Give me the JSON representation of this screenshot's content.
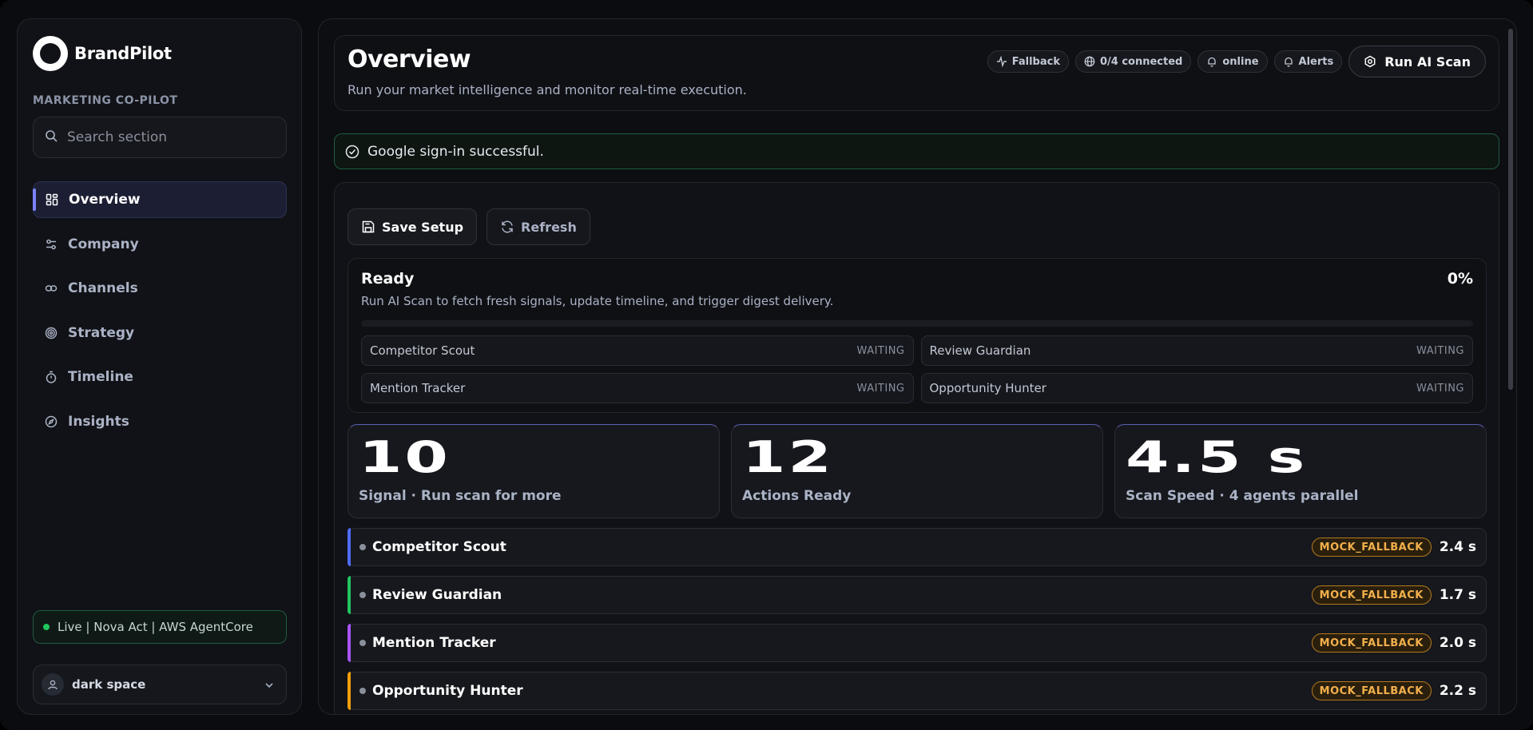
{
  "brand": {
    "name": "BrandPilot",
    "subtitle": "MARKETING CO-PILOT"
  },
  "search": {
    "placeholder": "Search section"
  },
  "nav": {
    "items": [
      {
        "label": "Overview",
        "icon": "dashboard-icon",
        "active": true
      },
      {
        "label": "Company",
        "icon": "sliders-icon"
      },
      {
        "label": "Channels",
        "icon": "link-icon"
      },
      {
        "label": "Strategy",
        "icon": "target-icon"
      },
      {
        "label": "Timeline",
        "icon": "stopwatch-icon"
      },
      {
        "label": "Insights",
        "icon": "compass-icon"
      }
    ]
  },
  "live_status": "Live | Nova Act | AWS AgentCore",
  "user": {
    "name": "dark space"
  },
  "header": {
    "title": "Overview",
    "subtitle": "Run your market intelligence and monitor real-time execution.",
    "chips": [
      "Fallback",
      "0/4 connected",
      "online",
      "Alerts"
    ],
    "run_label": "Run AI Scan"
  },
  "banner": "Google sign-in successful.",
  "toolbar": {
    "save_label": "Save Setup",
    "refresh_label": "Refresh"
  },
  "status": {
    "title": "Ready",
    "percent": "0%",
    "progress": 0,
    "description": "Run AI Scan to fetch fresh signals, update timeline, and trigger digest delivery.",
    "agents": [
      {
        "name": "Competitor Scout",
        "state": "WAITING"
      },
      {
        "name": "Review Guardian",
        "state": "WAITING"
      },
      {
        "name": "Mention Tracker",
        "state": "WAITING"
      },
      {
        "name": "Opportunity Hunter",
        "state": "WAITING"
      }
    ]
  },
  "stats": [
    {
      "value": "10",
      "label": "Signal · Run scan for more"
    },
    {
      "value": "12",
      "label": "Actions Ready"
    },
    {
      "value": "4.5 s",
      "label": "Scan Speed · 4 agents parallel"
    }
  ],
  "runs": [
    {
      "name": "Competitor Scout",
      "badge": "MOCK_FALLBACK",
      "time": "2.4 s",
      "color": "#4f6bff"
    },
    {
      "name": "Review Guardian",
      "badge": "MOCK_FALLBACK",
      "time": "1.7 s",
      "color": "#22c55e"
    },
    {
      "name": "Mention Tracker",
      "badge": "MOCK_FALLBACK",
      "time": "2.0 s",
      "color": "#a855f7"
    },
    {
      "name": "Opportunity Hunter",
      "badge": "MOCK_FALLBACK",
      "time": "2.2 s",
      "color": "#f59e0b"
    }
  ],
  "colors": {
    "accent": "#7c83ff",
    "success": "#22c55e",
    "warning": "#f2b04b"
  }
}
